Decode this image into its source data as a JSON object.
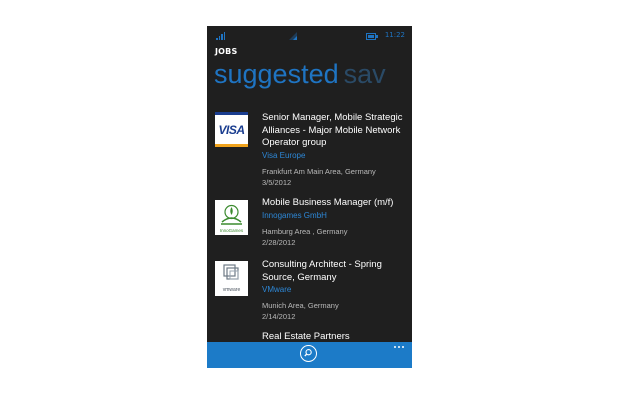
{
  "status_bar": {
    "time": "11:22",
    "signal_icon": "signal-bars-icon",
    "wifi_icon": "wifi-icon",
    "battery_icon": "battery-icon"
  },
  "app": {
    "title": "JOBS"
  },
  "pivot": {
    "active": "suggested",
    "next": "sav"
  },
  "jobs": [
    {
      "logo_text": "VISA",
      "title": "Senior Manager, Mobile Strategic Alliances - Major Mobile Network Operator group",
      "company": "Visa Europe",
      "location": "Frankfurt Am Main Area, Germany",
      "date": "3/5/2012"
    },
    {
      "logo_text": "InnoGames",
      "title": "Mobile Business Manager (m/f)",
      "company": "Innogames GmbH",
      "location": "Hamburg Area , Germany",
      "date": "2/28/2012"
    },
    {
      "logo_text": "vmware",
      "title": "Consulting Architect - Spring Source, Germany",
      "company": "VMware",
      "location": "Munich  Area, Germany",
      "date": "2/14/2012"
    },
    {
      "title": "Real Estate Partners"
    }
  ],
  "appbar": {
    "search_icon": "search-icon",
    "more_icon": "more-icon"
  },
  "colors": {
    "accent": "#1f74c2",
    "background": "#1f1f1f",
    "appbar": "#1c7bc8"
  }
}
